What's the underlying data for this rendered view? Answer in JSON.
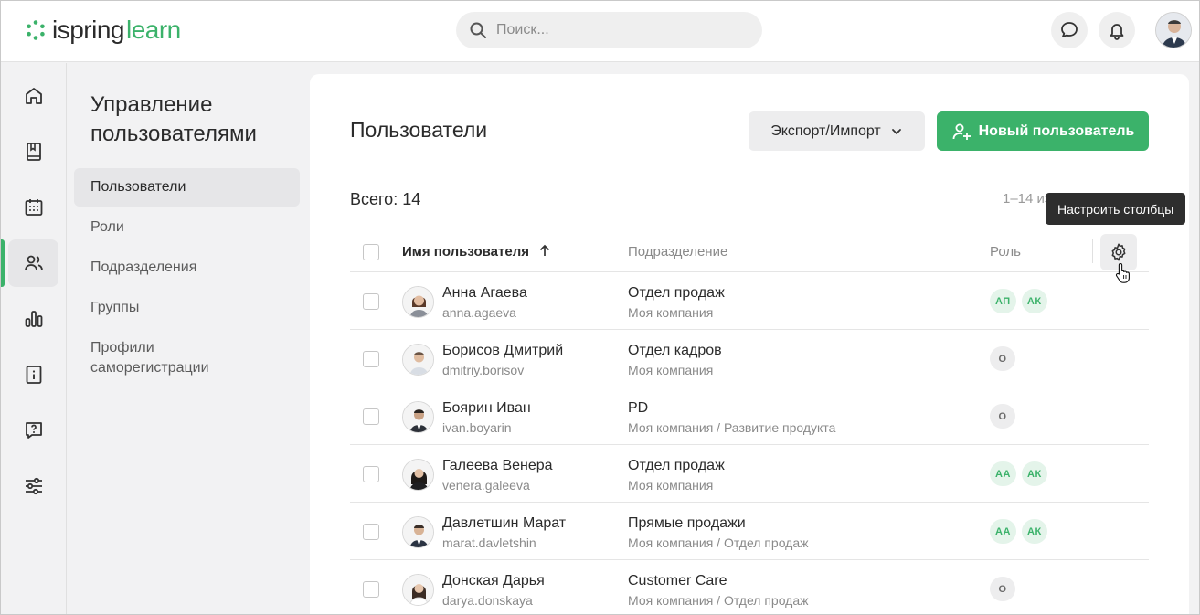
{
  "header": {
    "logo_word1": "ispring",
    "logo_word2": "learn",
    "search_placeholder": "Поиск...",
    "icons": [
      "search-icon",
      "chat-icon",
      "bell-icon"
    ]
  },
  "rail": {
    "items": [
      {
        "icon": "home-icon"
      },
      {
        "icon": "book-icon"
      },
      {
        "icon": "calendar-icon"
      },
      {
        "icon": "users-icon",
        "active": true
      },
      {
        "icon": "bar-chart-icon"
      },
      {
        "icon": "info-book-icon"
      },
      {
        "icon": "question-chat-icon"
      },
      {
        "icon": "sliders-icon"
      }
    ]
  },
  "subnav": {
    "title": "Управление пользователями",
    "items": [
      {
        "label": "Пользователи",
        "active": true
      },
      {
        "label": "Роли"
      },
      {
        "label": "Подразделения"
      },
      {
        "label": "Группы"
      },
      {
        "label": "Профили саморегистрации"
      }
    ]
  },
  "main": {
    "title": "Пользователи",
    "export_label": "Экспорт/Импорт",
    "new_user_label": "Новый пользователь",
    "total_label": "Всего: 14",
    "range_label": "1–14 из 14",
    "tooltip": "Настроить столбцы",
    "columns": {
      "name": "Имя пользователя",
      "department": "Подразделение",
      "role": "Роль"
    },
    "rows": [
      {
        "name": "Анна Агаева",
        "login": "anna.agaeva",
        "department": "Отдел продаж",
        "path": "Моя компания",
        "roles": [
          {
            "label": "АП",
            "style": "green"
          },
          {
            "label": "АК",
            "style": "green"
          }
        ]
      },
      {
        "name": "Борисов Дмитрий",
        "login": "dmitriy.borisov",
        "department": "Отдел кадров",
        "path": "Моя компания",
        "roles": [
          {
            "label": "О",
            "style": "grey"
          }
        ]
      },
      {
        "name": "Боярин Иван",
        "login": "ivan.boyarin",
        "department": "PD",
        "path": "Моя компания / Развитие продукта",
        "roles": [
          {
            "label": "О",
            "style": "grey"
          }
        ]
      },
      {
        "name": "Галеева Венера",
        "login": "venera.galeeva",
        "department": "Отдел продаж",
        "path": "Моя компания",
        "roles": [
          {
            "label": "АА",
            "style": "green"
          },
          {
            "label": "АК",
            "style": "green"
          }
        ]
      },
      {
        "name": "Давлетшин Марат",
        "login": "marat.davletshin",
        "department": "Прямые продажи",
        "path": "Моя компания / Отдел продаж",
        "roles": [
          {
            "label": "АА",
            "style": "green"
          },
          {
            "label": "АК",
            "style": "green"
          }
        ]
      },
      {
        "name": "Донская Дарья",
        "login": "darya.donskaya",
        "department": "Customer Care",
        "path": "Моя компания / Отдел продаж",
        "roles": [
          {
            "label": "О",
            "style": "grey"
          }
        ]
      }
    ]
  },
  "colors": {
    "accent": "#3bb26a",
    "badge_green_bg": "#e4f4ea",
    "badge_grey_bg": "#ededee",
    "tooltip_bg": "#2e2e2e"
  }
}
